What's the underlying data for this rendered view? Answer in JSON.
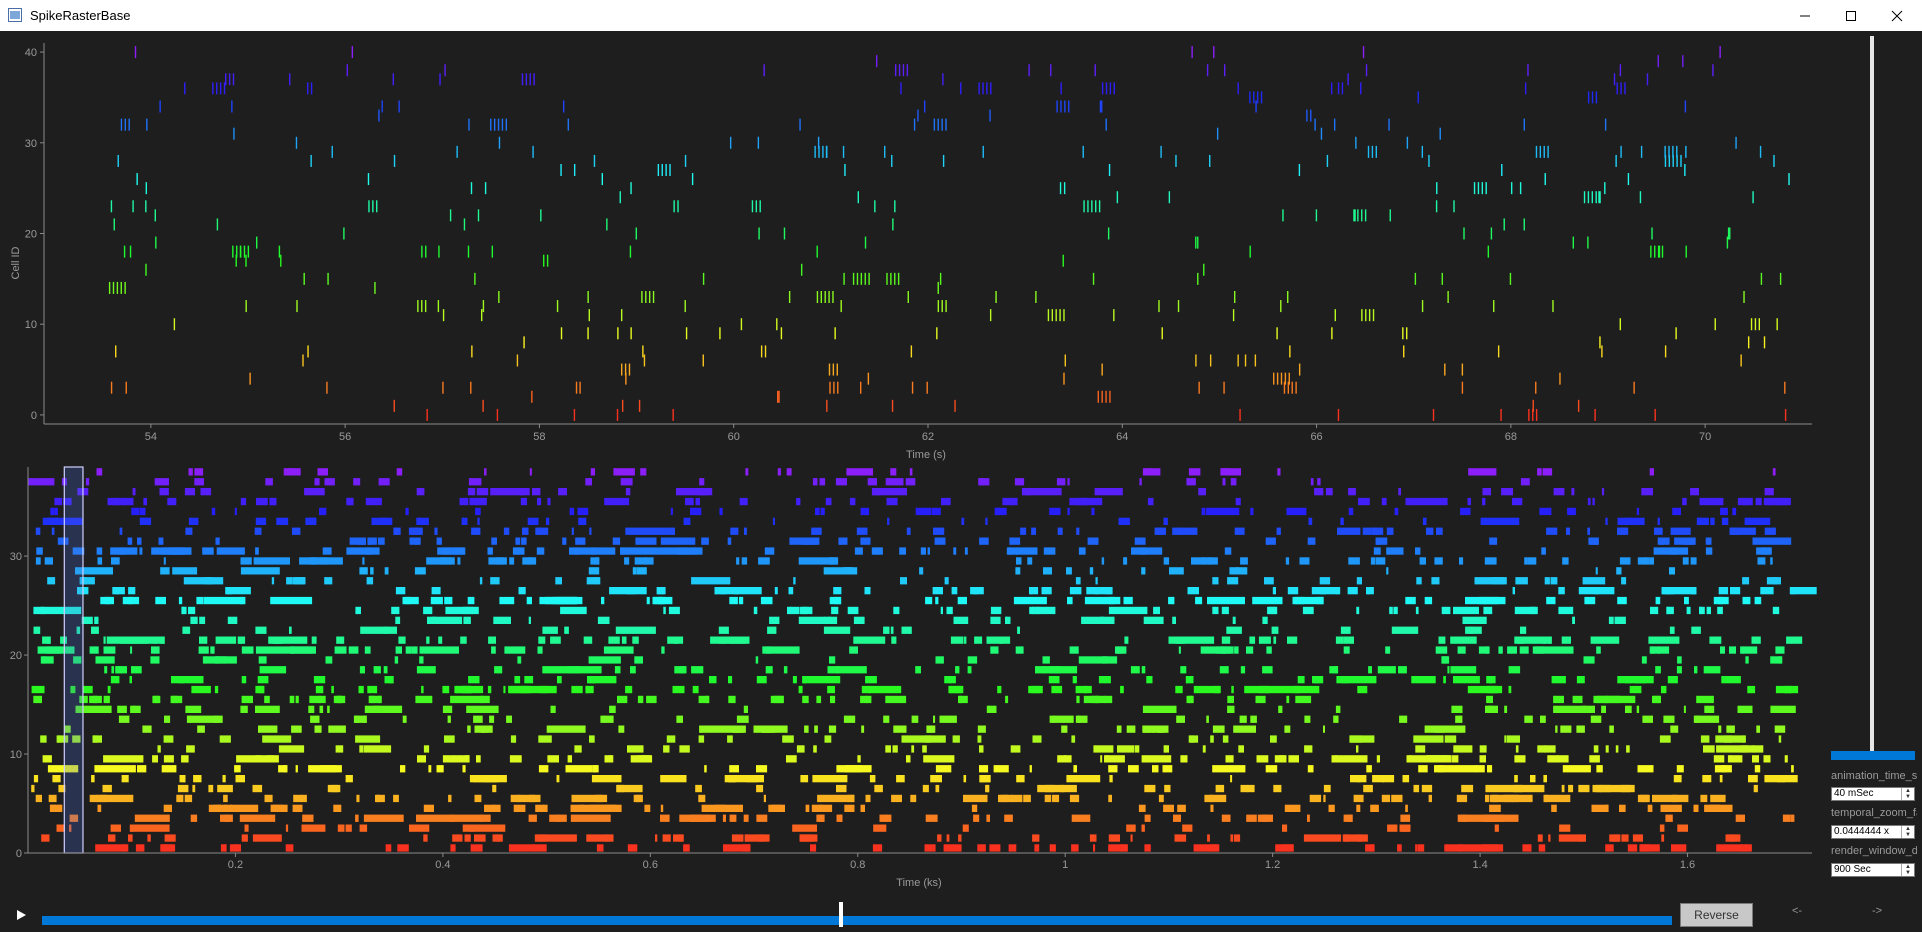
{
  "window": {
    "title": "SpikeRasterBase"
  },
  "colors": {
    "background": "#1e1e1e",
    "accent": "#0078d7",
    "axis": "#8a8a8a"
  },
  "icons": {
    "app": "window-app-icon",
    "minimize": "minimize-icon",
    "maximize": "maximize-icon",
    "close": "close-icon",
    "play": "play-icon"
  },
  "top_chart": {
    "ylabel": "Cell ID",
    "xlabel": "Time (s)",
    "xlim": [
      52.9,
      71.1
    ],
    "ylim": [
      -1,
      41
    ],
    "x_ticks": [
      "54",
      "56",
      "58",
      "60",
      "62",
      "64",
      "66",
      "68",
      "70"
    ],
    "y_ticks": [
      "0",
      "10",
      "20",
      "30",
      "40"
    ]
  },
  "bottom_chart": {
    "xlabel": "Time (ks)",
    "xlim": [
      0.0,
      1.72
    ],
    "ylim": [
      0,
      39
    ],
    "x_ticks": [
      "0.2",
      "0.4",
      "0.6",
      "0.8",
      "1",
      "1.2",
      "1.4",
      "1.6"
    ],
    "y_ticks": [
      "0",
      "10",
      "20",
      "30"
    ],
    "selection_window": [
      0.035,
      0.053
    ]
  },
  "controls": {
    "animation_time_step_label": "animation_time_st",
    "animation_time_step_value": "40 mSec",
    "temporal_zoom_label": "temporal_zoom_fa",
    "temporal_zoom_value": "0.0444444 x",
    "render_window_label": "render_window_d",
    "render_window_value": "900 Sec",
    "vertical_slider_level": 0.97
  },
  "playback": {
    "reverse_label": "Reverse",
    "back_label": "<-",
    "forward_label": "->",
    "position": 0.49
  }
}
